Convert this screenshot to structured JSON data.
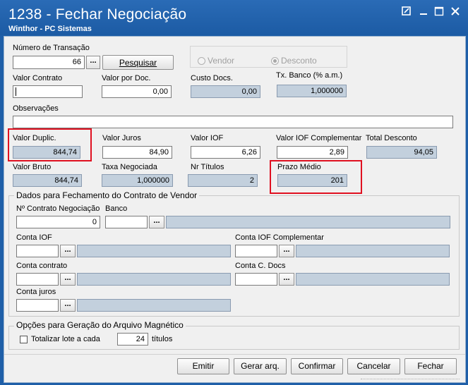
{
  "window": {
    "title": "1238 - Fechar Negociação",
    "subtitle": "Winthor - PC Sistemas",
    "controls": [
      "restore-icon",
      "minimize-icon",
      "maximize-icon",
      "close-icon"
    ]
  },
  "transacao": {
    "label": "Número de Transação",
    "value": "66",
    "dots": "...",
    "pesquisar": "Pesquisar"
  },
  "tipo": {
    "vendor": "Vendor",
    "desconto": "Desconto",
    "selected": "Desconto"
  },
  "row2": {
    "valor_contrato_label": "Valor Contrato",
    "valor_contrato": "",
    "valor_por_doc_label": "Valor por Doc.",
    "valor_por_doc": "0,00",
    "custo_docs_label": "Custo Docs.",
    "custo_docs": "0,00",
    "tx_banco_label": "Tx. Banco (% a.m.)",
    "tx_banco": "1,000000"
  },
  "observacoes": {
    "label": "Observações",
    "value": ""
  },
  "row3": {
    "valor_duplic_label": "Valor Duplic.",
    "valor_duplic": "844,74",
    "valor_juros_label": "Valor Juros",
    "valor_juros": "84,90",
    "valor_iof_label": "Valor IOF",
    "valor_iof": "6,26",
    "valor_iof_comp_label": "Valor IOF Complementar",
    "valor_iof_comp": "2,89",
    "total_desconto_label": "Total Desconto",
    "total_desconto": "94,05"
  },
  "row4": {
    "valor_bruto_label": "Valor Bruto",
    "valor_bruto": "844,74",
    "taxa_negociada_label": "Taxa Negociada",
    "taxa_negociada": "1,000000",
    "nr_titulos_label": "Nr Títulos",
    "nr_titulos": "2",
    "prazo_medio_label": "Prazo Médio",
    "prazo_medio": "201"
  },
  "contrato": {
    "group_title": "Dados para Fechamento do Contrato de Vendor",
    "nro_contrato_label": "Nº Contrato Negociação",
    "nro_contrato": "0",
    "banco_label": "Banco",
    "conta_iof_label": "Conta IOF",
    "conta_iof_comp_label": "Conta IOF Complementar",
    "conta_contrato_label": "Conta contrato",
    "conta_c_docs_label": "Conta C. Docs",
    "conta_juros_label": "Conta juros",
    "dots": "..."
  },
  "magnetico": {
    "group_title": "Opções para Geração do Arquivo Magnético",
    "totalizar_label": "Totalizar lote a cada",
    "quantidade": "24",
    "titulos_label": "títulos",
    "checked": false
  },
  "buttons": {
    "emitir": "Emitir",
    "gerar": "Gerar arq.",
    "confirmar": "Confirmar",
    "cancelar": "Cancelar",
    "fechar": "Fechar"
  }
}
